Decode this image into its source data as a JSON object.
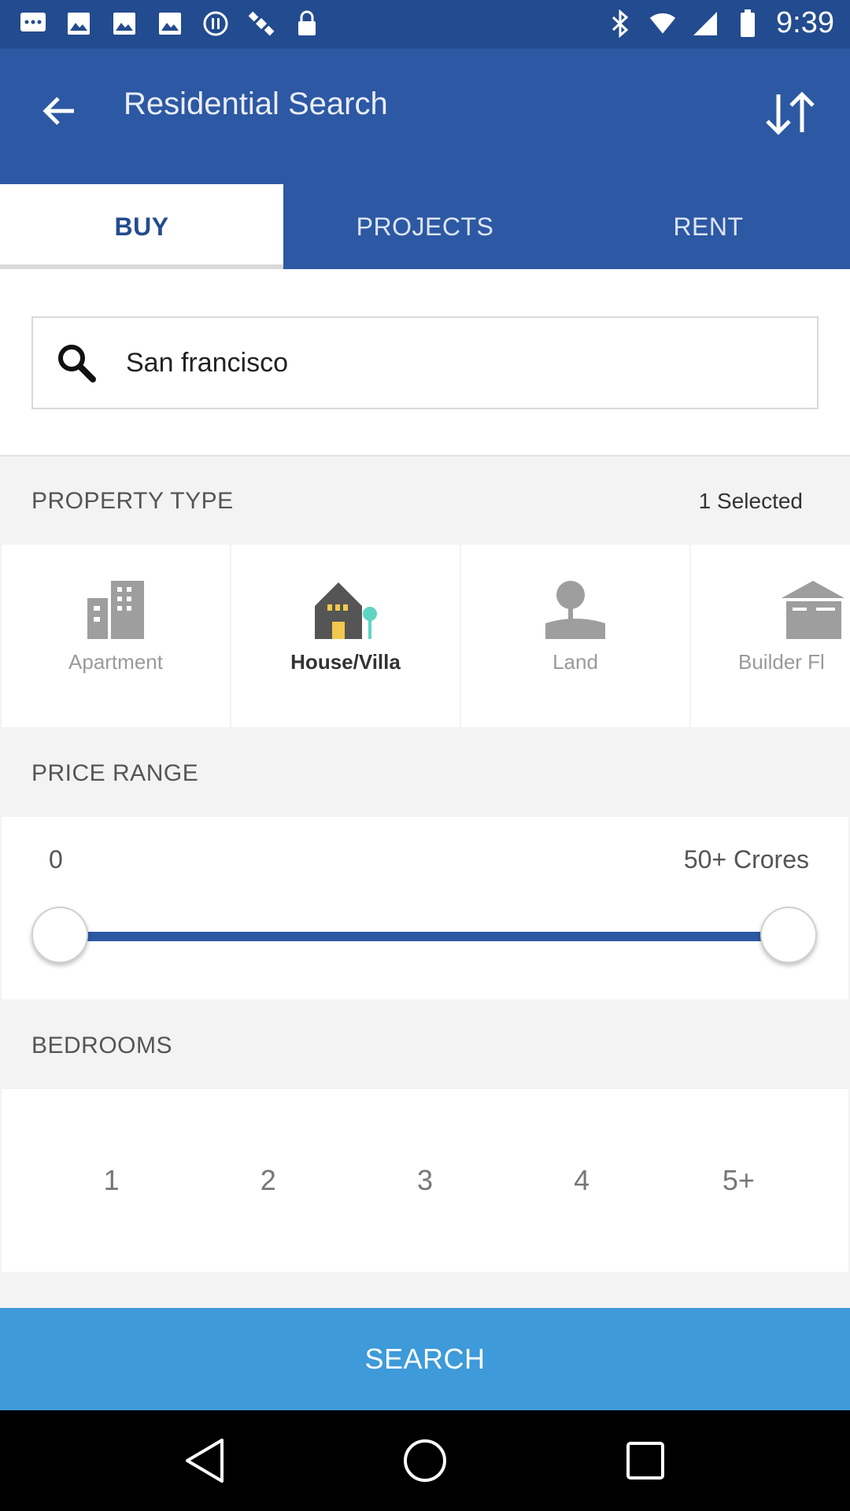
{
  "status_bar": {
    "time": "9:39",
    "left_icons": [
      "messages-icon",
      "image-icon",
      "image-icon",
      "image-icon",
      "media-icon",
      "satellite-icon",
      "lock-icon"
    ],
    "right_icons": [
      "bluetooth-icon",
      "wifi-icon",
      "signal-icon",
      "battery-icon"
    ]
  },
  "app_bar": {
    "title": "Residential Search",
    "tabs": [
      {
        "label": "BUY",
        "active": true
      },
      {
        "label": "PROJECTS",
        "active": false
      },
      {
        "label": "RENT",
        "active": false
      }
    ]
  },
  "search": {
    "value": "San francisco"
  },
  "property_type": {
    "title": "PROPERTY TYPE",
    "selected_label": "1 Selected",
    "options": [
      {
        "label": "Apartment",
        "icon": "apartment-icon",
        "selected": false
      },
      {
        "label": "House/Villa",
        "icon": "house-icon",
        "selected": true
      },
      {
        "label": "Land",
        "icon": "land-icon",
        "selected": false
      },
      {
        "label": "Builder Fl",
        "icon": "builder-floor-icon",
        "selected": false
      }
    ]
  },
  "price_range": {
    "title": "PRICE RANGE",
    "min_label": "0",
    "max_label": "50+ Crores",
    "min_fraction": 0,
    "max_fraction": 1
  },
  "bedrooms": {
    "title": "BEDROOMS",
    "options": [
      "1",
      "2",
      "3",
      "4",
      "5+"
    ]
  },
  "search_button": {
    "label": "SEARCH"
  },
  "colors": {
    "primary": "#2d58a3",
    "status_bar": "#234b8f",
    "accent_button": "#3e9ad9",
    "accent_teal": "#5fd5c4"
  }
}
